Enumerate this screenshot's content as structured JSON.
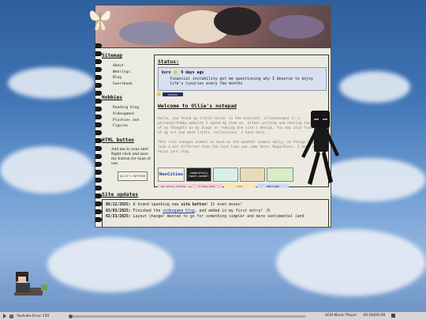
{
  "sidebar": {
    "sitemap_heading": "Sitemap",
    "sitemap_items": [
      "About",
      "Webrings",
      "Blog",
      "Guestbook"
    ],
    "hobbies_heading": "Hobbies",
    "hobbies_items": [
      "Reading blog",
      "Videogames",
      "Plushies and",
      "Figures"
    ],
    "html_heading": "HTML button",
    "html_note": "Add me to your site! Right click and save my button for ease of use.",
    "html_button_text": "OLLIE'S NOTEPAD"
  },
  "status": {
    "heading": "Status:",
    "author": "koro",
    "time_ago": "9 days ago",
    "text": "financial instability got me questioning why I deserve to enjoy life's luxuries every few months",
    "badge": "status"
  },
  "welcome": {
    "heading": "Welcome to Ollie's notepad",
    "paragraph1": "Hello, you found my little corner in the internet. ollienotepad is a personal/hobby website I spend my time on, either writing and sharing too much of my thoughts on my blogs or redoing the site's design. You may also find some of my art and what little 'collections' I have here.",
    "paragraph2": "This site changes almost as much as the weather almost daily, so things might look a bit different than the last time you came here. Regardless, I hope you enjoy your stay."
  },
  "buttons": {
    "neocities": "NeoCities",
    "handcoded": "completely hand-coded!",
    "blinky1": "My Online Friends",
    "blinky2": "I love cats",
    "blinky3": "Cozy",
    "blinky4": "UNPLUGGED"
  },
  "updates": {
    "heading": "Site updates",
    "entries": [
      {
        "date": "06/12/2025:",
        "pre": "A brand spanking new ",
        "bold": "site button",
        "post": "! It even moves!"
      },
      {
        "date": "03/03/2025:",
        "pre": "Finished the ",
        "link": "videogame blog",
        "post": ", and added in my first entry! :D"
      },
      {
        "date": "02/23/2025:",
        "pre": "Layout change! Wanted to go for something simpler and more sentimental (and",
        "post": ""
      }
    ]
  },
  "taskbar": {
    "left_label": "Youtube-Error 150",
    "right_label": "SCM Music Player",
    "time": "00:00|00:00"
  },
  "colors": {
    "page_bg": "#ecebe2",
    "status_box": "#d9e1ee",
    "sky": "#3f74b6"
  }
}
